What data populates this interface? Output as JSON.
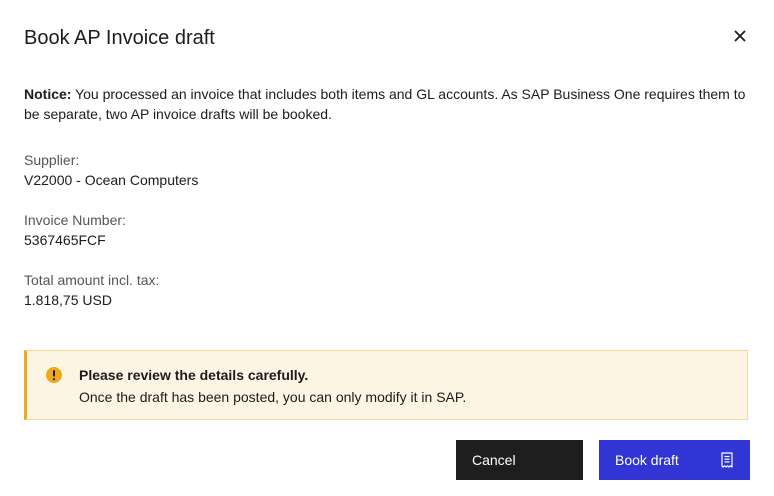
{
  "dialog": {
    "title": "Book AP Invoice draft",
    "close_icon": "close-icon"
  },
  "notice": {
    "label": "Notice:",
    "text": " You processed an invoice that includes both items and GL accounts. As SAP Business One requires them to be separate, two AP invoice drafts will be booked."
  },
  "fields": {
    "supplier": {
      "label": "Supplier:",
      "value": "V22000 - Ocean Computers"
    },
    "invoice_number": {
      "label": "Invoice Number:",
      "value": "5367465FCF"
    },
    "total_amount": {
      "label": "Total amount incl. tax:",
      "value": "1.818,75 USD"
    }
  },
  "alert": {
    "icon": "warning-icon",
    "title": "Please review the details carefully.",
    "text": "Once the draft has been posted, you can only modify it in SAP.",
    "colors": {
      "background": "#fdf5e4",
      "accent": "#f0a81c"
    }
  },
  "buttons": {
    "cancel_label": "Cancel",
    "book_label": "Book draft",
    "book_icon": "receipt-icon"
  },
  "colors": {
    "primary": "#3135d4",
    "dark": "#1e1e1e"
  }
}
